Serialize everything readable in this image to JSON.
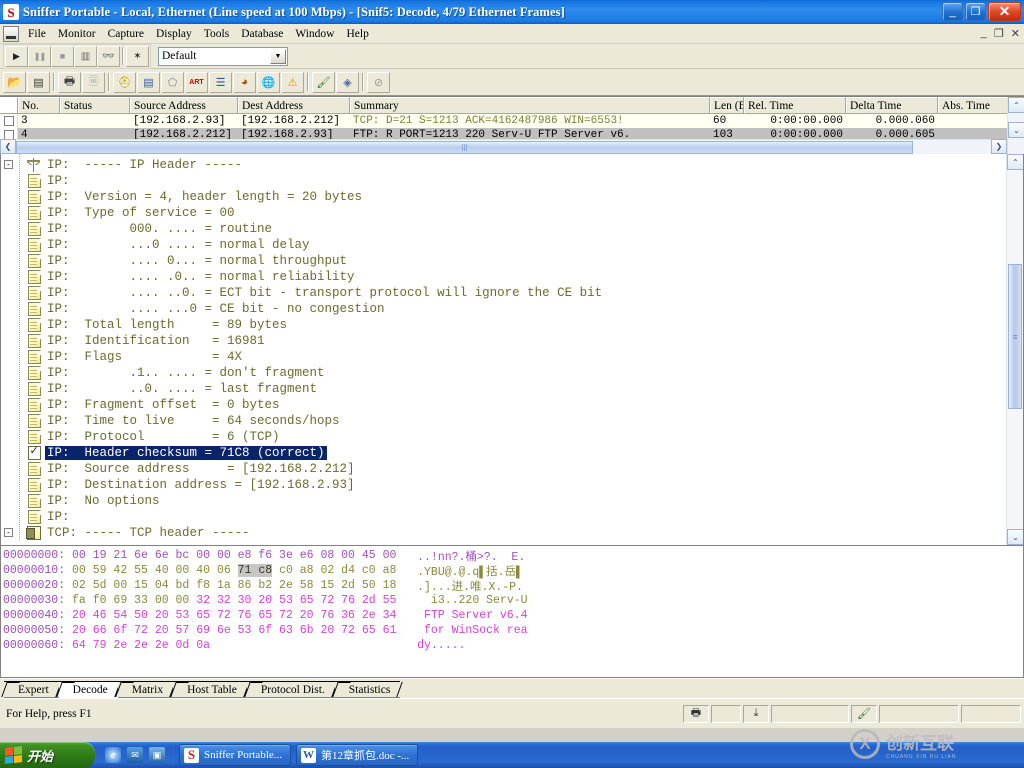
{
  "window": {
    "title": "Sniffer Portable - Local, Ethernet (Line speed at 100 Mbps) - [Snif5: Decode, 4/79 Ethernet Frames]",
    "app_icon": "S",
    "minimize": "_",
    "maximize": "❐",
    "close": "✕",
    "child_minimize": "_",
    "child_maximize": "❐",
    "child_close": "✕"
  },
  "menu": {
    "items": [
      {
        "label": "File"
      },
      {
        "label": "Monitor"
      },
      {
        "label": "Capture"
      },
      {
        "label": "Display"
      },
      {
        "label": "Tools"
      },
      {
        "label": "Database"
      },
      {
        "label": "Window"
      },
      {
        "label": "Help"
      }
    ]
  },
  "toolbar1": {
    "buttons": [
      {
        "name": "start-capture-button",
        "glyph": "▶"
      },
      {
        "name": "pause-capture-button",
        "glyph": "❙❙"
      },
      {
        "name": "stop-capture-button",
        "glyph": "■"
      },
      {
        "name": "stop-and-display-button",
        "glyph": "▣"
      },
      {
        "name": "display-button",
        "glyph": "🔭"
      },
      {
        "name": "capture-filter-button",
        "glyph": "✎"
      }
    ],
    "profile_combo": {
      "value": "Default",
      "arrow": "▼"
    }
  },
  "toolbar2": {
    "buttons": [
      {
        "name": "open-file-button",
        "glyph": "📂"
      },
      {
        "name": "save-file-button",
        "glyph": "💾"
      },
      {
        "name": "print-button",
        "glyph": "🖶"
      },
      {
        "name": "print-preview-button",
        "glyph": "🗐"
      },
      {
        "name": "expert-button",
        "glyph": "⛑"
      },
      {
        "name": "decode-button",
        "glyph": "🖹"
      },
      {
        "name": "matrix-button",
        "glyph": "⬠"
      },
      {
        "name": "art-button",
        "glyph": "ART"
      },
      {
        "name": "host-table-button",
        "glyph": "▤"
      },
      {
        "name": "protocol-dist-button",
        "glyph": "◓"
      },
      {
        "name": "global-statistics-button",
        "glyph": "🌐"
      },
      {
        "name": "alarm-log-button",
        "glyph": "⚠"
      },
      {
        "name": "capture-panel-button",
        "glyph": "🖌"
      },
      {
        "name": "packet-generator-button",
        "glyph": "◈"
      },
      {
        "name": "stop-display-button",
        "glyph": "⊘"
      }
    ]
  },
  "packet_list": {
    "columns": [
      {
        "label": "No.",
        "key": "no"
      },
      {
        "label": "Status",
        "key": "status"
      },
      {
        "label": "Source Address",
        "key": "src"
      },
      {
        "label": "Dest Address",
        "key": "dst"
      },
      {
        "label": "Summary",
        "key": "summary"
      },
      {
        "label": "Len (B",
        "key": "len"
      },
      {
        "label": "Rel. Time",
        "key": "rel"
      },
      {
        "label": "Delta Time",
        "key": "delta"
      },
      {
        "label": "Abs. Time",
        "key": "abs"
      }
    ],
    "rows": [
      {
        "no": "3",
        "status": "",
        "src": "[192.168.2.93]",
        "dst": "[192.168.2.212]",
        "summary": "TCP: D=21 S=1213      ACK=4162487986 WIN=6553!",
        "len": "60",
        "rel": "0:00:00.000",
        "delta": "0.000.060",
        "abs": "",
        "selected": false
      },
      {
        "no": "4",
        "status": "",
        "src": "[192.168.2.212]",
        "dst": "[192.168.2.93]",
        "summary": "FTP: R PORT=1213    220 Serv-U FTP Server v6.",
        "len": "103",
        "rel": "0:00:00.000",
        "delta": "0.000.605",
        "abs": "",
        "selected": true
      }
    ],
    "scroll_left_arrow": "❮",
    "scroll_right_arrow": "❯",
    "scroll_up_arrow": "⌃",
    "scroll_down_arrow": "⌄"
  },
  "decode_tree": {
    "rows": [
      {
        "type": "root",
        "icon": "ip-root-icon",
        "text": "IP:  ----- IP Header -----"
      },
      {
        "type": "leaf",
        "icon": "page-icon",
        "text": "IP:"
      },
      {
        "type": "leaf",
        "icon": "page-icon",
        "text": "IP:  Version = 4, header length = 20 bytes"
      },
      {
        "type": "leaf",
        "icon": "page-icon",
        "text": "IP:  Type of service = 00"
      },
      {
        "type": "leaf",
        "icon": "page-icon",
        "text": "IP:        000. .... = routine"
      },
      {
        "type": "leaf",
        "icon": "page-icon",
        "text": "IP:        ...0 .... = normal delay"
      },
      {
        "type": "leaf",
        "icon": "page-icon",
        "text": "IP:        .... 0... = normal throughput"
      },
      {
        "type": "leaf",
        "icon": "page-icon",
        "text": "IP:        .... .0.. = normal reliability"
      },
      {
        "type": "leaf",
        "icon": "page-icon",
        "text": "IP:        .... ..0. = ECT bit - transport protocol will ignore the CE bit"
      },
      {
        "type": "leaf",
        "icon": "page-icon",
        "text": "IP:        .... ...0 = CE bit - no congestion"
      },
      {
        "type": "leaf",
        "icon": "page-icon",
        "text": "IP:  Total length     = 89 bytes"
      },
      {
        "type": "leaf",
        "icon": "page-icon",
        "text": "IP:  Identification   = 16981"
      },
      {
        "type": "leaf",
        "icon": "page-icon",
        "text": "IP:  Flags            = 4X"
      },
      {
        "type": "leaf",
        "icon": "page-icon",
        "text": "IP:        .1.. .... = don't fragment"
      },
      {
        "type": "leaf",
        "icon": "page-icon",
        "text": "IP:        ..0. .... = last fragment"
      },
      {
        "type": "leaf",
        "icon": "page-icon",
        "text": "IP:  Fragment offset  = 0 bytes"
      },
      {
        "type": "leaf",
        "icon": "page-icon",
        "text": "IP:  Time to live     = 64 seconds/hops"
      },
      {
        "type": "leaf",
        "icon": "page-icon",
        "text": "IP:  Protocol         = 6 (TCP)"
      },
      {
        "type": "leaf",
        "icon": "check-icon",
        "text": "IP:  Header checksum = 71C8 (correct)",
        "selected": true
      },
      {
        "type": "leaf",
        "icon": "page-icon",
        "text": "IP:  Source address     = [192.168.2.212]"
      },
      {
        "type": "leaf",
        "icon": "page-icon",
        "text": "IP:  Destination address = [192.168.2.93]"
      },
      {
        "type": "leaf",
        "icon": "page-icon",
        "text": "IP:  No options"
      },
      {
        "type": "leaf",
        "icon": "page-icon",
        "text": "IP:"
      },
      {
        "type": "root",
        "icon": "tcp-root-icon",
        "text": "TCP: ----- TCP header -----"
      }
    ],
    "expander_collapse": "-",
    "scroll_up_arrow": "⌃",
    "scroll_down_arrow": "⌄"
  },
  "hex_dump": {
    "rows": [
      {
        "offset": "00000000:",
        "bytes_pre": "00 19 21 6e 6e bc 00 00 e8 f6 3e e6 08 00 ",
        "bytes_sel": "",
        "bytes_post": "45 00",
        "ascii": "..!nn?.桶>?.  E.",
        "class": "mac"
      },
      {
        "offset": "00000010:",
        "bytes_pre": "00 59 42 55 40 00 40 06 ",
        "bytes_sel": "71 c8",
        "bytes_post": " c0 a8 02 d4 c0 a8",
        "ascii": ".YBU@.@.q▌括.岳▌",
        "class": "hdr"
      },
      {
        "offset": "00000020:",
        "bytes_pre": "02 5d 00 15 04 bd f8 1a 86 b2 2e 58 15 2d 50 18",
        "bytes_sel": "",
        "bytes_post": "",
        "ascii": ".]...进.唯.X.-P.",
        "class": "hdr"
      },
      {
        "offset": "00000030:",
        "bytes_pre": "fa f0 69 33 00 00 ",
        "bytes_sel": "",
        "bytes_post": "32 32 30 20 53 65 72 76 2d 55",
        "ascii": "  i3..220 Serv-U",
        "class": "mixed"
      },
      {
        "offset": "00000040:",
        "bytes_pre": "",
        "bytes_sel": "",
        "bytes_post": "20 46 54 50 20 53 65 72 76 65 72 20 76 36 2e 34",
        "ascii": " FTP Server v6.4",
        "class": "data"
      },
      {
        "offset": "00000050:",
        "bytes_pre": "",
        "bytes_sel": "",
        "bytes_post": "20 66 6f 72 20 57 69 6e 53 6f 63 6b 20 72 65 61",
        "ascii": " for WinSock rea",
        "class": "data"
      },
      {
        "offset": "00000060:",
        "bytes_pre": "",
        "bytes_sel": "",
        "bytes_post": "64 79 2e 2e 2e 0d 0a",
        "ascii": "dy.....",
        "class": "data"
      }
    ]
  },
  "bottom_tabs": {
    "tabs": [
      {
        "label": "Expert",
        "active": false
      },
      {
        "label": "Decode",
        "active": true
      },
      {
        "label": "Matrix",
        "active": false
      },
      {
        "label": "Host Table",
        "active": false
      },
      {
        "label": "Protocol Dist.",
        "active": false
      },
      {
        "label": "Statistics",
        "active": false
      }
    ]
  },
  "status_bar": {
    "text": "For Help, press F1",
    "printer_icon": "🖶",
    "capture_icon": "⤓",
    "brush_icon": "🖌"
  },
  "taskbar": {
    "start_label": "开始",
    "quick_launch": [
      {
        "name": "internet-explorer-icon",
        "glyph": "e"
      },
      {
        "name": "outlook-express-icon",
        "glyph": "✉"
      },
      {
        "name": "media-player-icon",
        "glyph": "▣"
      }
    ],
    "items": [
      {
        "label": "Sniffer Portable...",
        "icon": "S",
        "active": true
      },
      {
        "label": "第12章抓包.doc -...",
        "icon": "W",
        "active": false
      }
    ]
  },
  "watermark": {
    "mark": "X",
    "text": "创新互联",
    "sub": "CHUANG XIN HU LIAN"
  },
  "colors": {
    "title_blue": "#1b7ae2",
    "selection_blue": "#0a246a",
    "row_selected_gray": "#c0c0c0",
    "tree_olive": "#6b6b2e",
    "hex_magenta": "#d93fd9",
    "hex_olive": "#8a8a3a",
    "hex_offset_purple": "#9a4fbf",
    "face": "#ece9d8"
  }
}
